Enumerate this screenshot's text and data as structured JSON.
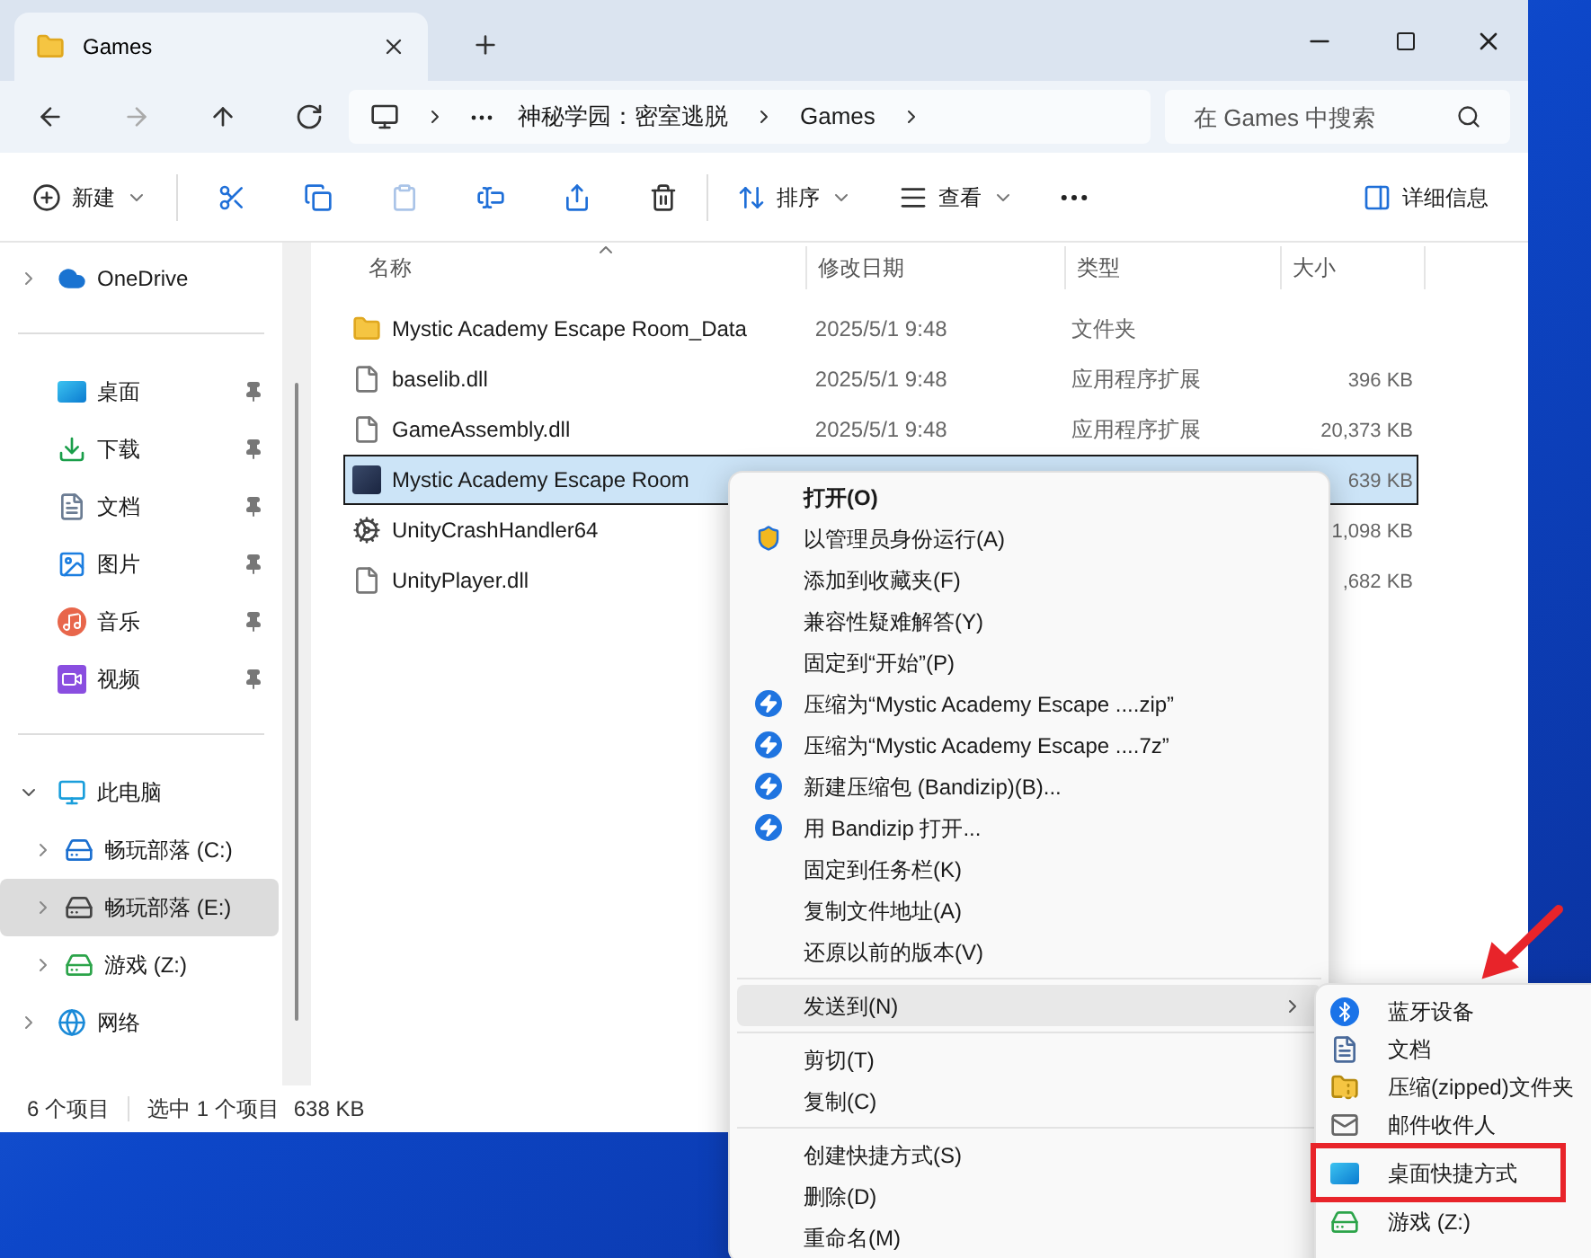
{
  "window": {
    "tab_title": "Games"
  },
  "address_bar": {
    "segments": [
      "神秘学园：密室逃脱",
      "Games"
    ]
  },
  "search": {
    "placeholder": "在 Games 中搜索"
  },
  "toolbar": {
    "new": "新建",
    "sort": "排序",
    "view": "查看",
    "details": "详细信息"
  },
  "sidebar": {
    "sections": [
      [
        {
          "label": "OneDrive",
          "kind": "cloud",
          "expanded": false,
          "selected": false
        }
      ],
      [
        {
          "label": "桌面",
          "kind": "desktop",
          "pinned": true,
          "selected": false
        },
        {
          "label": "下载",
          "kind": "download",
          "pinned": true,
          "selected": false
        },
        {
          "label": "文档",
          "kind": "docs",
          "pinned": true,
          "selected": false
        },
        {
          "label": "图片",
          "kind": "pictures",
          "pinned": true,
          "selected": false
        },
        {
          "label": "音乐",
          "kind": "music",
          "pinned": true,
          "selected": false
        },
        {
          "label": "视频",
          "kind": "video",
          "pinned": true,
          "selected": false
        }
      ],
      [
        {
          "label": "此电脑",
          "kind": "pc",
          "expanded": true,
          "selected": false,
          "children": [
            {
              "label": "畅玩部落 (C:)",
              "kind": "system-drive",
              "expanded": false,
              "selected": false
            },
            {
              "label": "畅玩部落 (E:)",
              "kind": "drive",
              "expanded": false,
              "selected": true
            },
            {
              "label": "游戏 (Z:)",
              "kind": "net-drive",
              "expanded": false,
              "selected": false
            }
          ]
        },
        {
          "label": "网络",
          "kind": "network",
          "expanded": false,
          "selected": false
        }
      ]
    ]
  },
  "table": {
    "columns": [
      "名称",
      "修改日期",
      "类型",
      "大小"
    ],
    "rows": [
      {
        "name": "Mystic Academy Escape Room_Data",
        "kind": "folder",
        "date": "2025/5/1 9:48",
        "type": "文件夹",
        "selected": false
      },
      {
        "name": "baselib.dll",
        "kind": "dll",
        "date": "2025/5/1 9:48",
        "type": "应用程序扩展",
        "size": "396 KB",
        "selected": false
      },
      {
        "name": "GameAssembly.dll",
        "kind": "dll",
        "date": "2025/5/1 9:48",
        "type": "应用程序扩展",
        "size": "20,373 KB",
        "selected": false
      },
      {
        "name": "Mystic Academy Escape Room",
        "kind": "app",
        "size": "639 KB",
        "selected": true
      },
      {
        "name": "UnityCrashHandler64",
        "kind": "unity",
        "size": "1,098 KB",
        "selected": false
      },
      {
        "name": "UnityPlayer.dll",
        "kind": "dll",
        "size": ",682 KB",
        "selected": false
      }
    ]
  },
  "status_bar": {
    "items": [
      "6 个项目",
      "选中 1 个项目",
      "638 KB"
    ]
  },
  "context_menu": {
    "sections": [
      [
        {
          "label": "打开(O)",
          "kind": "default",
          "selected": false
        },
        {
          "label": "以管理员身份运行(A)",
          "kind": "shield",
          "selected": false
        },
        {
          "label": "添加到收藏夹(F)",
          "kind": "plain",
          "selected": false
        },
        {
          "label": "兼容性疑难解答(Y)",
          "kind": "plain",
          "selected": false
        },
        {
          "label": "固定到“开始”(P)",
          "kind": "plain",
          "selected": false
        },
        {
          "label": "压缩为“Mystic Academy Escape ....zip”",
          "kind": "bandizip",
          "selected": false
        },
        {
          "label": "压缩为“Mystic Academy Escape ....7z”",
          "kind": "bandizip",
          "selected": false
        },
        {
          "label": "新建压缩包 (Bandizip)(B)...",
          "kind": "bandizip",
          "selected": false
        },
        {
          "label": "用 Bandizip 打开...",
          "kind": "bandizip",
          "selected": false
        },
        {
          "label": "固定到任务栏(K)",
          "kind": "plain",
          "selected": false
        },
        {
          "label": "复制文件地址(A)",
          "kind": "plain",
          "selected": false
        },
        {
          "label": "还原以前的版本(V)",
          "kind": "plain",
          "selected": false
        }
      ],
      [
        {
          "label": "发送到(N)",
          "kind": "submenu",
          "selected": true
        }
      ],
      [
        {
          "label": "剪切(T)",
          "kind": "plain",
          "selected": false
        },
        {
          "label": "复制(C)",
          "kind": "plain",
          "selected": false
        }
      ],
      [
        {
          "label": "创建快捷方式(S)",
          "kind": "plain",
          "selected": false
        },
        {
          "label": "删除(D)",
          "kind": "plain",
          "selected": false
        },
        {
          "label": "重命名(M)",
          "kind": "plain",
          "selected": false
        }
      ]
    ]
  },
  "send_to_menu": {
    "items": [
      {
        "label": "蓝牙设备",
        "kind": "bluetooth",
        "highlighted": false
      },
      {
        "label": "文档",
        "kind": "docs",
        "highlighted": false
      },
      {
        "label": "压缩(zipped)文件夹",
        "kind": "zip",
        "highlighted": false
      },
      {
        "label": "邮件收件人",
        "kind": "mail",
        "highlighted": false
      },
      {
        "label": "桌面快捷方式",
        "kind": "desktop",
        "highlighted": true
      },
      {
        "label": "游戏 (Z:)",
        "kind": "net-drive",
        "highlighted": false
      }
    ]
  }
}
